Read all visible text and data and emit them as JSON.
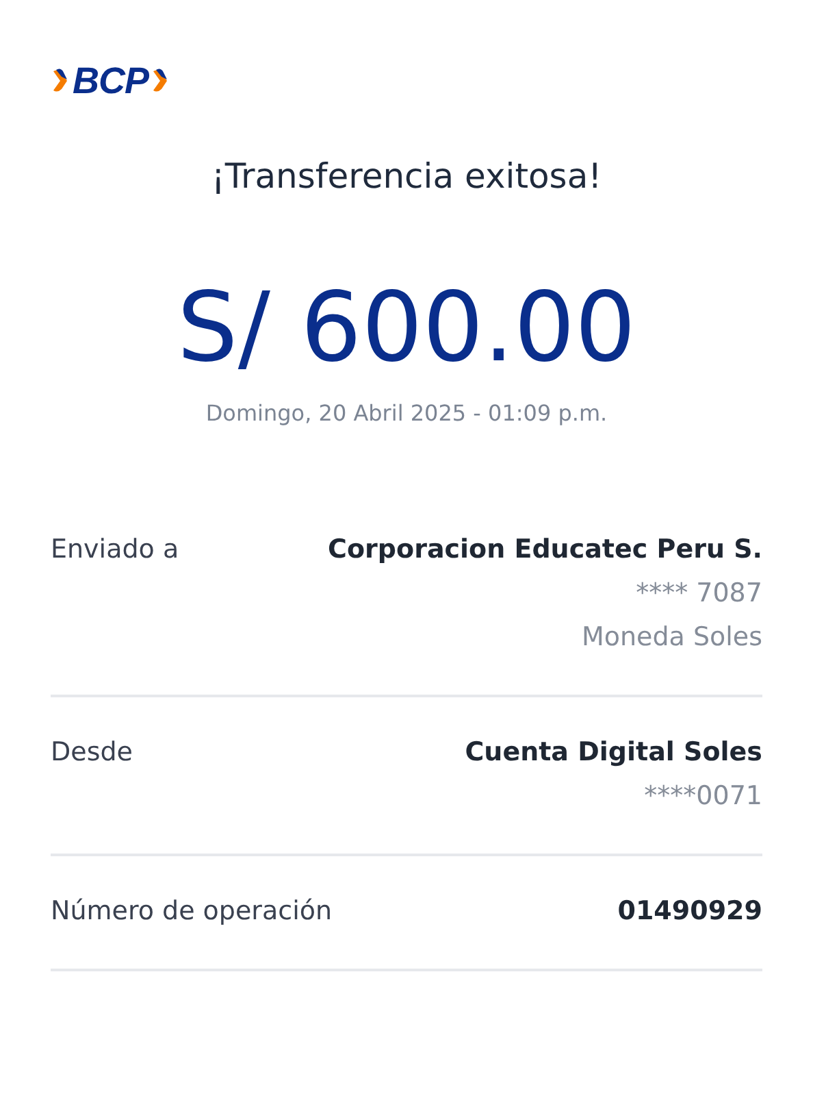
{
  "logo": {
    "text": "BCP"
  },
  "title": "¡Transferencia exitosa!",
  "amount": "S/ 600.00",
  "date": "Domingo, 20 Abril 2025 - 01:09 p.m.",
  "details": [
    {
      "label": "Enviado a",
      "values": [
        {
          "text": "Corporacion Educatec Peru S.",
          "kind": "primary"
        },
        {
          "text": "**** 7087",
          "kind": "secondary"
        },
        {
          "text": "Moneda Soles",
          "kind": "secondary"
        }
      ]
    },
    {
      "label": "Desde",
      "values": [
        {
          "text": "Cuenta Digital Soles",
          "kind": "primary"
        },
        {
          "text": "****0071",
          "kind": "secondary"
        }
      ]
    },
    {
      "label": "Número de operación",
      "values": [
        {
          "text": "01490929",
          "kind": "primary"
        }
      ]
    }
  ]
}
